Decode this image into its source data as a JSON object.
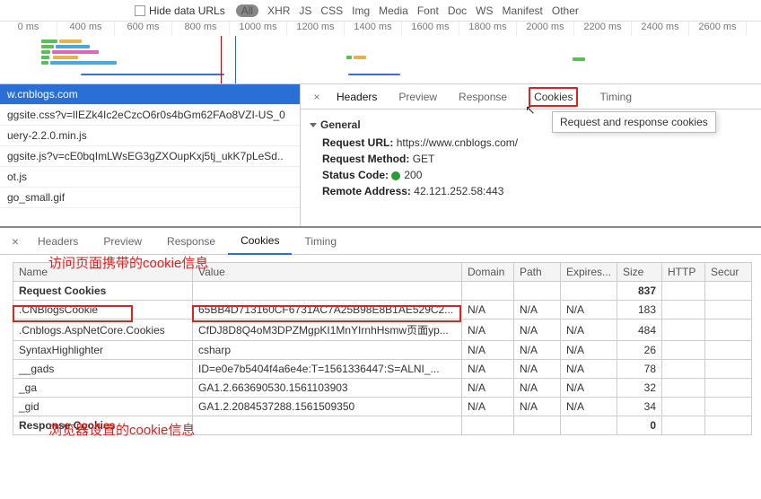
{
  "topbar": {
    "hide_label": "Hide data URLs",
    "filters": [
      "All",
      "XHR",
      "JS",
      "CSS",
      "Img",
      "Media",
      "Font",
      "Doc",
      "WS",
      "Manifest",
      "Other"
    ]
  },
  "timeline": {
    "ticks": [
      "0 ms",
      "400 ms",
      "600 ms",
      "800 ms",
      "1000 ms",
      "1200 ms",
      "1400 ms",
      "1600 ms",
      "1800 ms",
      "2000 ms",
      "2200 ms",
      "2400 ms",
      "2600 ms"
    ]
  },
  "requests": [
    "w.cnblogs.com",
    "ggsite.css?v=lIEZk4Ic2eCzcO6r0s4bGm62FAo8VZI-US_0",
    "uery-2.2.0.min.js",
    "ggsite.js?v=cE0bqImLWsEG3gZXOupKxj5tj_ukK7pLeSd..",
    "ot.js",
    "go_small.gif"
  ],
  "detail": {
    "tabs": [
      "Headers",
      "Preview",
      "Response",
      "Cookies",
      "Timing"
    ],
    "tooltip": "Request and response cookies",
    "section_general": "General",
    "url_label": "Request URL:",
    "url_value": "https://www.cnblogs.com/",
    "method_label": "Request Method:",
    "method_value": "GET",
    "status_label": "Status Code:",
    "status_value": "200",
    "remote_label": "Remote Address:",
    "remote_value": "42.121.252.58:443"
  },
  "pane2": {
    "tabs": [
      "Headers",
      "Preview",
      "Response",
      "Cookies",
      "Timing"
    ],
    "annot_top": "访问页面携带的cookie信息",
    "annot_bot": "浏览器设置的cookie信息",
    "headers": [
      "Name",
      "Value",
      "Domain",
      "Path",
      "Expires...",
      "Size",
      "HTTP",
      "Secur"
    ],
    "request_cookies_label": "Request Cookies",
    "response_cookies_label": "Response Cookies",
    "req_total": "837",
    "res_total": "0",
    "rows": [
      {
        "name": ".CNBlogsCookie",
        "value": "65BB4D713160CF6731AC7A25B98E8B1AE529C2...",
        "domain": "N/A",
        "path": "N/A",
        "exp": "N/A",
        "size": "183"
      },
      {
        "name": ".Cnblogs.AspNetCore.Cookies",
        "value": "CfDJ8D8Q4oM3DPZMgpKI1MnYIrnhHsmw页面yp...",
        "domain": "N/A",
        "path": "N/A",
        "exp": "N/A",
        "size": "484"
      },
      {
        "name": "SyntaxHighlighter",
        "value": "csharp",
        "domain": "N/A",
        "path": "N/A",
        "exp": "N/A",
        "size": "26"
      },
      {
        "name": "__gads",
        "value": "ID=e0e7b5404f4a6e4e:T=1561336447:S=ALNI_...",
        "domain": "N/A",
        "path": "N/A",
        "exp": "N/A",
        "size": "78"
      },
      {
        "name": "_ga",
        "value": "GA1.2.663690530.1561103903",
        "domain": "N/A",
        "path": "N/A",
        "exp": "N/A",
        "size": "32"
      },
      {
        "name": "_gid",
        "value": "GA1.2.2084537288.1561509350",
        "domain": "N/A",
        "path": "N/A",
        "exp": "N/A",
        "size": "34"
      }
    ]
  }
}
